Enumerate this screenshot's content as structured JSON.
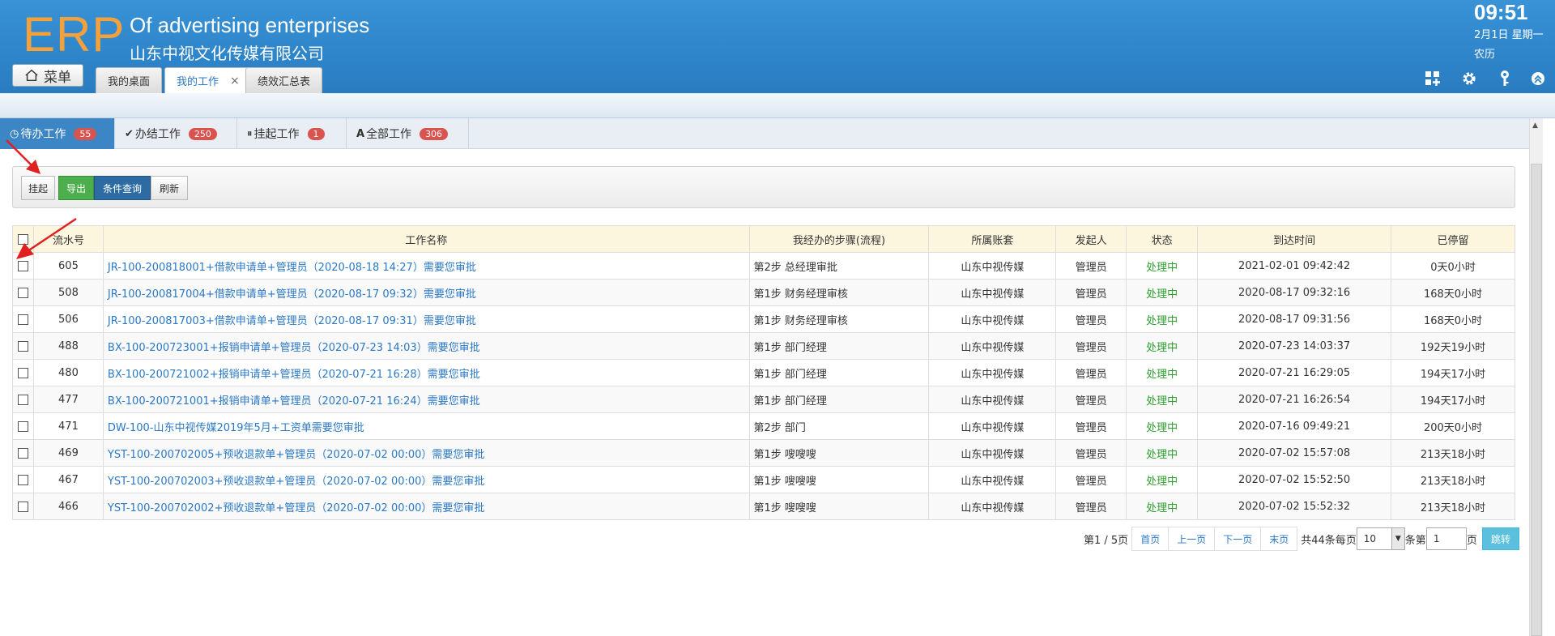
{
  "header": {
    "logo": "ERP",
    "company_en": "Of advertising enterprises",
    "company_cn": "山东中视文化传媒有限公司",
    "menu_label": "菜单",
    "tabs": [
      {
        "label": "我的桌面"
      },
      {
        "label": "我的工作",
        "close": "×"
      },
      {
        "label": "绩效汇总表"
      }
    ],
    "time": "09:51",
    "date": "2月1日 星期一",
    "lunar": "农历",
    "icons": [
      "grid-add-icon",
      "gear-icon",
      "key-icon",
      "collapse-up-icon"
    ]
  },
  "worktabs": [
    {
      "label": "待办工作",
      "count": "55",
      "icon": "clock-icon"
    },
    {
      "label": "办结工作",
      "count": "250",
      "icon": "check-icon"
    },
    {
      "label": "挂起工作",
      "count": "1",
      "icon": "pause-icon"
    },
    {
      "label": "全部工作",
      "count": "306",
      "icon": "all-icon"
    }
  ],
  "toolbar": {
    "suspend": "挂起",
    "export": "导出",
    "query": "条件查询",
    "refresh": "刷新"
  },
  "table": {
    "columns": [
      "流水号",
      "工作名称",
      "我经办的步骤(流程)",
      "所属账套",
      "发起人",
      "状态",
      "到达时间",
      "已停留"
    ],
    "rows": [
      {
        "id": "605",
        "name": "JR-100-200818001+借款申请单+管理员（2020-08-18 14:27）需要您审批",
        "step": "第2步 总经理审批",
        "account": "山东中视传媒",
        "initiator": "管理员",
        "status": "处理中",
        "arrival": "2021-02-01 09:42:42",
        "stay": "0天0小时"
      },
      {
        "id": "508",
        "name": "JR-100-200817004+借款申请单+管理员（2020-08-17 09:32）需要您审批",
        "step": "第1步 财务经理审核",
        "account": "山东中视传媒",
        "initiator": "管理员",
        "status": "处理中",
        "arrival": "2020-08-17 09:32:16",
        "stay": "168天0小时"
      },
      {
        "id": "506",
        "name": "JR-100-200817003+借款申请单+管理员（2020-08-17 09:31）需要您审批",
        "step": "第1步 财务经理审核",
        "account": "山东中视传媒",
        "initiator": "管理员",
        "status": "处理中",
        "arrival": "2020-08-17 09:31:56",
        "stay": "168天0小时"
      },
      {
        "id": "488",
        "name": "BX-100-200723001+报销申请单+管理员（2020-07-23 14:03）需要您审批",
        "step": "第1步 部门经理",
        "account": "山东中视传媒",
        "initiator": "管理员",
        "status": "处理中",
        "arrival": "2020-07-23 14:03:37",
        "stay": "192天19小时"
      },
      {
        "id": "480",
        "name": "BX-100-200721002+报销申请单+管理员（2020-07-21 16:28）需要您审批",
        "step": "第1步 部门经理",
        "account": "山东中视传媒",
        "initiator": "管理员",
        "status": "处理中",
        "arrival": "2020-07-21 16:29:05",
        "stay": "194天17小时"
      },
      {
        "id": "477",
        "name": "BX-100-200721001+报销申请单+管理员（2020-07-21 16:24）需要您审批",
        "step": "第1步 部门经理",
        "account": "山东中视传媒",
        "initiator": "管理员",
        "status": "处理中",
        "arrival": "2020-07-21 16:26:54",
        "stay": "194天17小时"
      },
      {
        "id": "471",
        "name": "DW-100-山东中视传媒2019年5月+工资单需要您审批",
        "step": "第2步 部门",
        "account": "山东中视传媒",
        "initiator": "管理员",
        "status": "处理中",
        "arrival": "2020-07-16 09:49:21",
        "stay": "200天0小时"
      },
      {
        "id": "469",
        "name": "YST-100-200702005+预收退款单+管理员（2020-07-02 00:00）需要您审批",
        "step": "第1步 嗖嗖嗖",
        "account": "山东中视传媒",
        "initiator": "管理员",
        "status": "处理中",
        "arrival": "2020-07-02 15:57:08",
        "stay": "213天18小时"
      },
      {
        "id": "467",
        "name": "YST-100-200702003+预收退款单+管理员（2020-07-02 00:00）需要您审批",
        "step": "第1步 嗖嗖嗖",
        "account": "山东中视传媒",
        "initiator": "管理员",
        "status": "处理中",
        "arrival": "2020-07-02 15:52:50",
        "stay": "213天18小时"
      },
      {
        "id": "466",
        "name": "YST-100-200702002+预收退款单+管理员（2020-07-02 00:00）需要您审批",
        "step": "第1步 嗖嗖嗖",
        "account": "山东中视传媒",
        "initiator": "管理员",
        "status": "处理中",
        "arrival": "2020-07-02 15:52:32",
        "stay": "213天18小时"
      }
    ]
  },
  "pager": {
    "page_info": "第1 / 5页",
    "first": "首页",
    "prev": "上一页",
    "next": "下一页",
    "last": "末页",
    "total_label": "共44条每页",
    "per_page": "10",
    "per_unit": "条第",
    "page_value": "1",
    "page_unit": "页",
    "go": "跳转"
  },
  "colors": {
    "header_blue": "#2f86cb",
    "logo_orange": "#f5a13b",
    "active_tab": "#3d86c6",
    "badge_red": "#d9534f",
    "export_green": "#4cae4c",
    "query_blue": "#2d6ca2",
    "status_green": "#2e9e2e",
    "link_blue": "#2b78c5",
    "header_row": "#fdf6df"
  }
}
